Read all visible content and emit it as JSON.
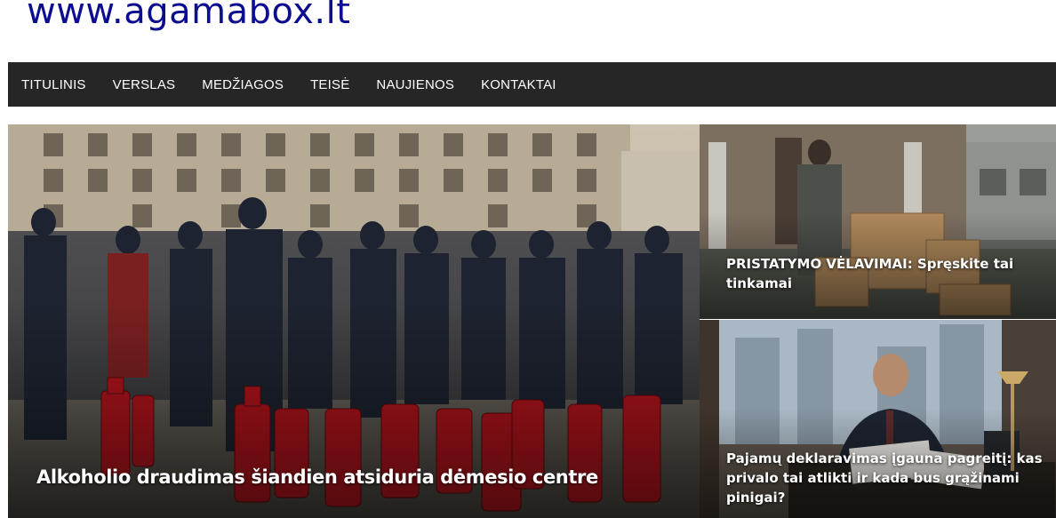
{
  "site": {
    "title": "www.agamabox.lt"
  },
  "nav": {
    "items": [
      {
        "label": "TITULINIS"
      },
      {
        "label": "VERSLAS"
      },
      {
        "label": "MEDŽIAGOS"
      },
      {
        "label": "TEISĖ"
      },
      {
        "label": "NAUJIENOS"
      },
      {
        "label": "KONTAKTAI"
      }
    ]
  },
  "articles": {
    "main": {
      "title": "Alkoholio draudimas šiandien atsiduria dėmesio centre"
    },
    "top_right": {
      "title": "PRISTATYMO VĖLAVIMAI: Spręskite tai tinkamai"
    },
    "bottom_right": {
      "title": "Pajamų deklaravimas įgauna pagreitį: kas privalo tai atlikti ir kada bus grąžinami pinigai?"
    }
  },
  "colors": {
    "site_title": "#0d0d8f",
    "nav_background": "#262626",
    "nav_text": "#ffffff"
  }
}
